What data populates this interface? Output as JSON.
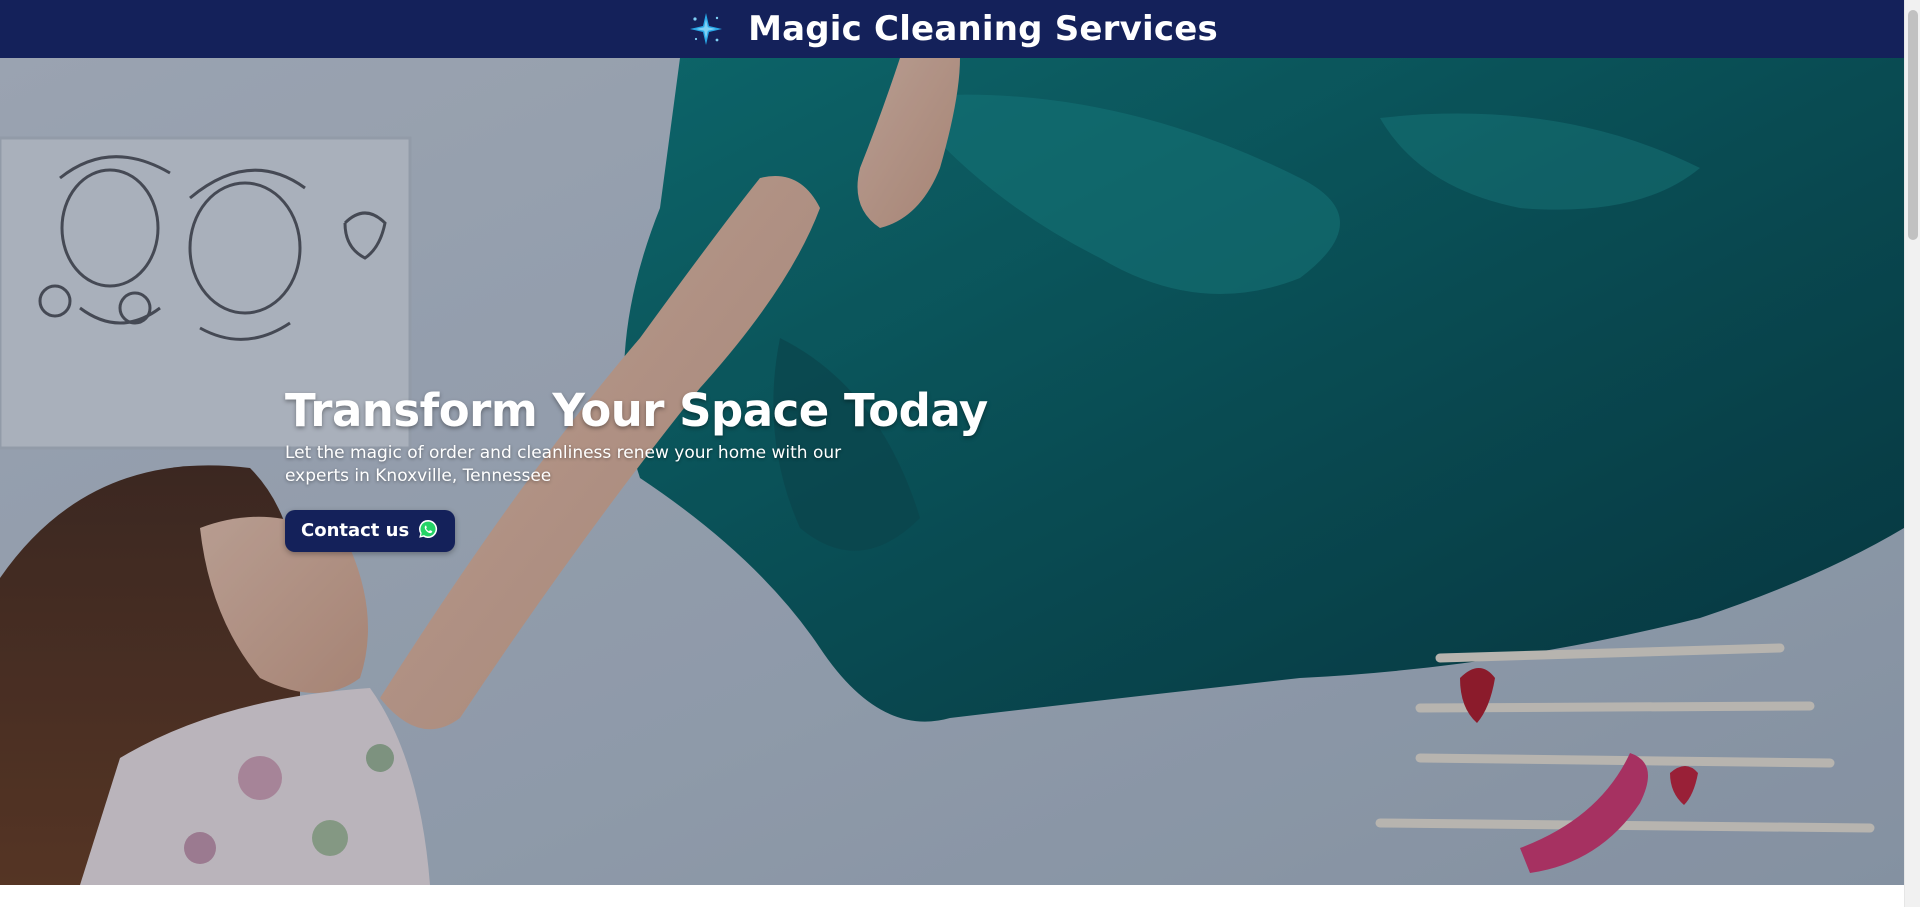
{
  "header": {
    "logo_icon": "sparkle-star-icon",
    "brand_name": "Magic Cleaning Services",
    "background_color": "#14215a"
  },
  "hero": {
    "title": "Transform Your Space Today",
    "subtitle": "Let the magic of order and cleanliness renew your home with our experts in Knoxville, Tennessee",
    "cta": {
      "label": "Contact us",
      "icon": "whatsapp-icon",
      "background_color": "#14215a",
      "icon_color": "#25d366"
    },
    "image_subject": "woman-spreading-teal-bedsheet-photo"
  },
  "colors": {
    "accent_teal": "#0d6b6b",
    "logo_blue": "#29a8e8"
  }
}
